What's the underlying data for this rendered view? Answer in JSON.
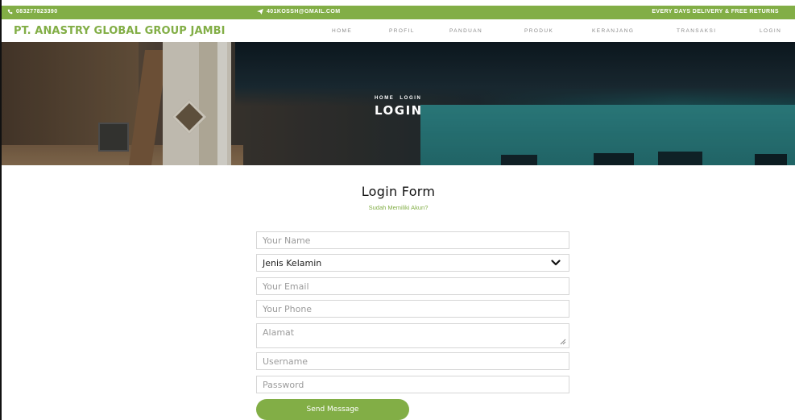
{
  "topbar": {
    "phone": "083277823390",
    "email": "401KOSSH@GMAIL.COM",
    "tagline": "EVERY DAYS DELIVERY & FREE RETURNS"
  },
  "navbar": {
    "brand": "PT. ANASTRY GLOBAL GROUP JAMBI",
    "items": [
      "HOME",
      "PROFIL",
      "PANDUAN",
      "PRODUK",
      "KERANJANG",
      "TRANSAKSI",
      "LOGIN"
    ]
  },
  "hero": {
    "breadcrumb": [
      "HOME",
      "LOGIN"
    ],
    "title": "LOGIN"
  },
  "form": {
    "title": "Login Form",
    "subtitle": "Sudah Memiliki Akun?",
    "name_placeholder": "Your Name",
    "gender_value": "Jenis Kelamin",
    "email_placeholder": "Your Email",
    "phone_placeholder": "Your Phone",
    "address_placeholder": "Alamat",
    "username_placeholder": "Username",
    "password_placeholder": "Password",
    "submit_label": "Send Message"
  },
  "colors": {
    "accent": "#82ae46",
    "nav_text": "#8a8a8a",
    "border": "#d6d6d6"
  },
  "icons": {
    "phone": "phone-icon",
    "email": "paper-plane-icon",
    "select": "chevron-down-icon",
    "resize": "resize-handle-icon"
  }
}
